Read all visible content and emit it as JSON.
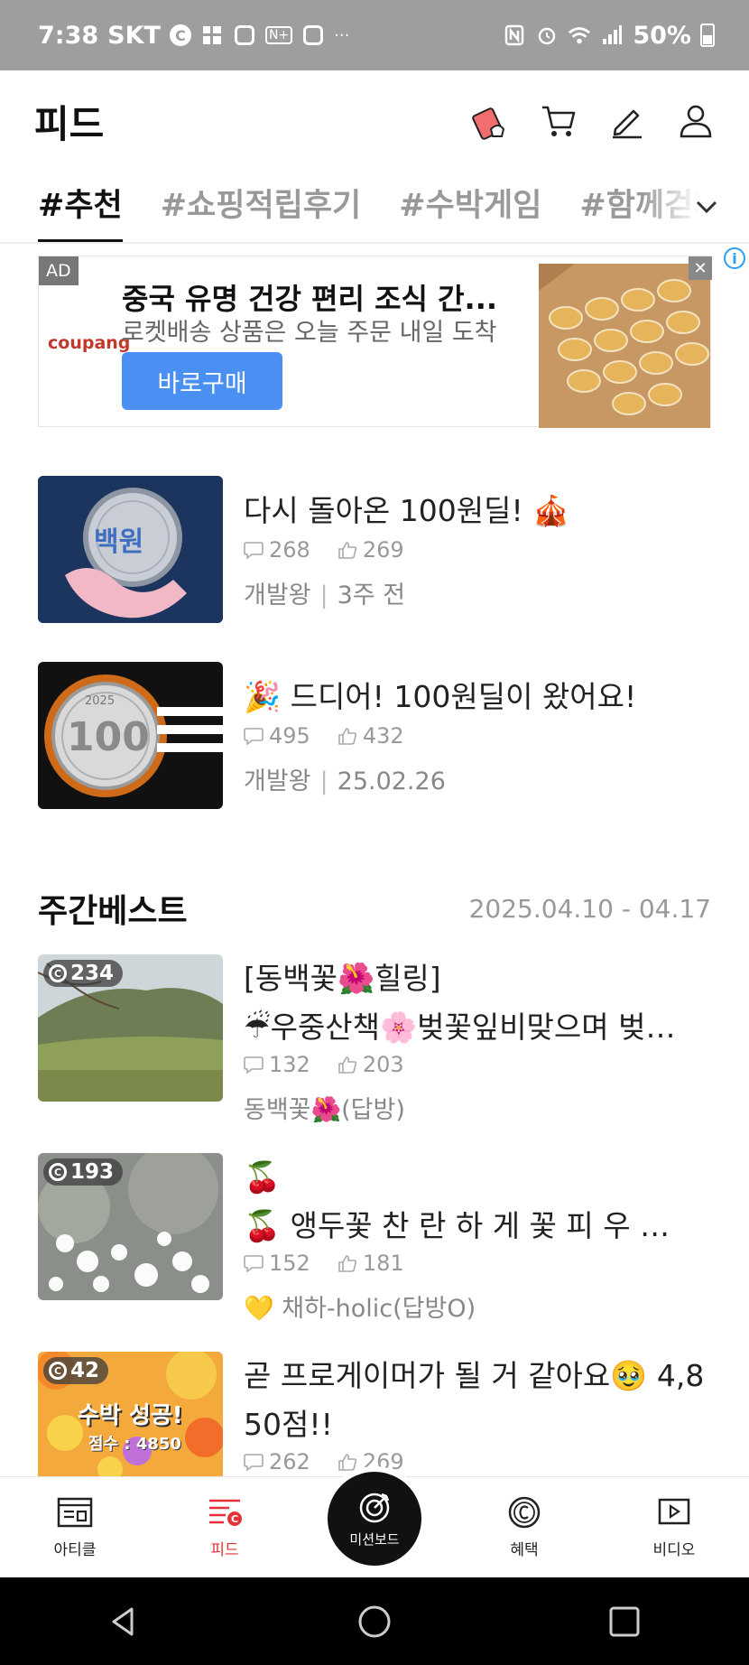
{
  "status_bar": {
    "time": "7:38",
    "carrier": "SKT",
    "battery": "50%",
    "overflow": "···"
  },
  "header": {
    "title": "피드"
  },
  "tabs": [
    {
      "label": "#추천",
      "active": true
    },
    {
      "label": "#쇼핑적립후기",
      "active": false
    },
    {
      "label": "#수박게임",
      "active": false
    },
    {
      "label": "#함께걷기인증",
      "active": false
    }
  ],
  "ad": {
    "label": "AD",
    "brand": "coupang",
    "title": "중국 유명 건강 편리 조식 간...",
    "subtitle": "로켓배송 상품은 오늘 주문 내일 도착",
    "button": "바로구매",
    "close": "✕",
    "info": "i"
  },
  "feed_items": [
    {
      "title": "다시 돌아온 100원딜! 🎪",
      "comments": "268",
      "likes": "269",
      "author": "개발왕",
      "time": "3주 전",
      "thumb_text": "백원"
    },
    {
      "title": "🎉 드디어! 100원딜이 왔어요!",
      "comments": "495",
      "likes": "432",
      "author": "개발왕",
      "time": "25.02.26",
      "thumb_text": "100",
      "thumb_year": "2025"
    }
  ],
  "weekly": {
    "title": "주간베스트",
    "date_range": "2025.04.10 - 04.17",
    "items": [
      {
        "badge": "234",
        "title_line1": "[동백꽃🌺힐링]",
        "title_line2": "☔우중산책🌸벚꽃잎비맞으며 벚…",
        "comments": "132",
        "likes": "203",
        "author": "동백꽃🌺(답방)"
      },
      {
        "badge": "193",
        "title_line1": "🍒",
        "title_line2": "🍒 앵두꽃 찬 란 하 게 꽃 피 우 …",
        "comments": "152",
        "likes": "181",
        "author": "💛 채하-holic(답방O)"
      },
      {
        "badge": "42",
        "title_line1": "곧 프로게이머가 될 거 같아요🥹 4,8",
        "title_line2": "50점!!",
        "comments": "262",
        "likes": "269",
        "thumb_text": "수박 성공!",
        "thumb_score": "점수 : 4850"
      }
    ]
  },
  "bottom_nav": [
    {
      "label": "아티클",
      "icon": "article-icon"
    },
    {
      "label": "피드",
      "icon": "feed-icon",
      "active": true
    },
    {
      "label": "미션보드",
      "icon": "target-icon"
    },
    {
      "label": "혜택",
      "icon": "coin-icon"
    },
    {
      "label": "비디오",
      "icon": "video-icon"
    }
  ],
  "colors": {
    "accent": "#e4343a",
    "ad_button": "#4a90f2",
    "status_bar": "#9e9e9e"
  }
}
